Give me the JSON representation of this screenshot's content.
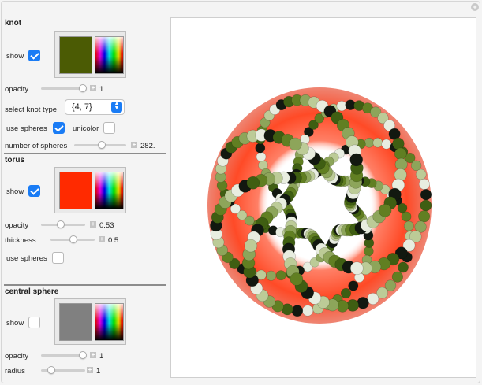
{
  "knot": {
    "heading": "knot",
    "show_label": "show",
    "show_checked": true,
    "color": "#4b5b04",
    "opacity_label": "opacity",
    "opacity_value": "1",
    "opacity_fraction": 1.0,
    "select_label": "select knot type",
    "knot_type": "{4, 7}",
    "use_spheres_label": "use spheres",
    "use_spheres_checked": true,
    "unicolor_label": "unicolor",
    "unicolor_checked": false,
    "num_spheres_label": "number of spheres",
    "num_spheres_value": "282.",
    "num_spheres_fraction": 0.7
  },
  "torus": {
    "heading": "torus",
    "show_label": "show",
    "show_checked": true,
    "color": "#ff2a00",
    "opacity_label": "opacity",
    "opacity_value": "0.53",
    "opacity_fraction": 0.53,
    "thickness_label": "thickness",
    "thickness_value": "0.5",
    "thickness_fraction": 0.5,
    "use_spheres_label": "use spheres",
    "use_spheres_checked": false
  },
  "central_sphere": {
    "heading": "central sphere",
    "show_label": "show",
    "show_checked": false,
    "color": "#808080",
    "opacity_label": "opacity",
    "opacity_value": "1",
    "opacity_fraction": 1.0,
    "radius_label": "radius",
    "radius_value": "1",
    "radius_fraction": 0.2
  },
  "icons": {
    "corner": "plus-circle-icon",
    "slider_increment": "plus-icon",
    "select_arrows": "up-down-chevron-icon",
    "checkbox": "checkmark-icon"
  },
  "colors": {
    "accent": "#1a7cf5",
    "bead_shades": [
      "#3f5e12",
      "#617f22",
      "#8da55a",
      "#bccb97",
      "#e8ede0",
      "#121810"
    ]
  }
}
